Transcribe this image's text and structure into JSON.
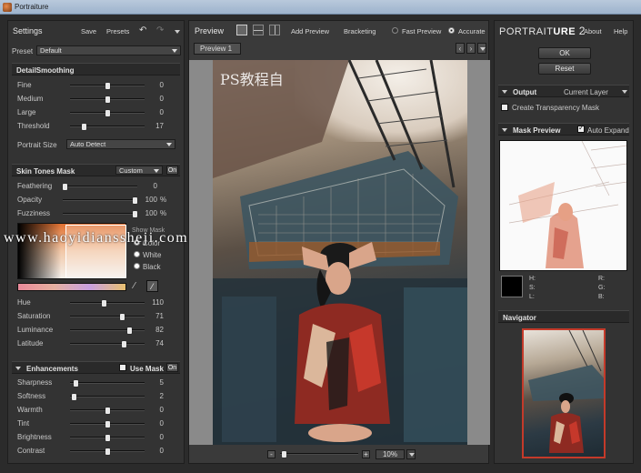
{
  "window": {
    "title": "Portraiture"
  },
  "left": {
    "header": {
      "title": "Settings",
      "save": "Save",
      "presets": "Presets"
    },
    "preset": {
      "label": "Preset",
      "value": "Default"
    },
    "detail": {
      "title": "DetailSmoothing",
      "sliders": [
        {
          "label": "Fine",
          "value": "0",
          "pos": 0.5
        },
        {
          "label": "Medium",
          "value": "0",
          "pos": 0.5
        },
        {
          "label": "Large",
          "value": "0",
          "pos": 0.5
        },
        {
          "label": "Threshold",
          "value": "17",
          "pos": 0.17
        }
      ],
      "portrait_size": {
        "label": "Portrait Size",
        "value": "Auto Detect"
      }
    },
    "skin": {
      "title": "Skin Tones Mask",
      "mode": "Custom",
      "on": "On",
      "sliders": [
        {
          "label": "Feathering",
          "value": "0",
          "unit": "",
          "pos": 0.0
        },
        {
          "label": "Opacity",
          "value": "100",
          "unit": "%",
          "pos": 1.0
        },
        {
          "label": "Fuzziness",
          "value": "100",
          "unit": "%",
          "pos": 1.0
        }
      ],
      "show_mask": "Show Mask",
      "mask_options": [
        "Color",
        "White",
        "Black"
      ],
      "hsl": [
        {
          "label": "Hue",
          "value": "110",
          "pos": 0.45
        },
        {
          "label": "Saturation",
          "value": "71",
          "pos": 0.71
        },
        {
          "label": "Luminance",
          "value": "82",
          "pos": 0.82
        },
        {
          "label": "Latitude",
          "value": "74",
          "pos": 0.74
        }
      ]
    },
    "enh": {
      "title": "Enhancements",
      "use_mask": "Use Mask",
      "on": "On",
      "sliders": [
        {
          "label": "Sharpness",
          "value": "5",
          "pos": 0.05
        },
        {
          "label": "Softness",
          "value": "2",
          "pos": 0.02
        },
        {
          "label": "Warmth",
          "value": "0",
          "pos": 0.5
        },
        {
          "label": "Tint",
          "value": "0",
          "pos": 0.5
        },
        {
          "label": "Brightness",
          "value": "0",
          "pos": 0.5
        },
        {
          "label": "Contrast",
          "value": "0",
          "pos": 0.5
        }
      ]
    }
  },
  "center": {
    "title": "Preview",
    "add_preview": "Add Preview",
    "bracketing": "Bracketing",
    "fast_preview": "Fast Preview",
    "accurate": "Accurate",
    "tab": "Preview 1",
    "zoom": "10%",
    "minus": "-",
    "plus": "+"
  },
  "right": {
    "logo_left": "PORTRAIT",
    "logo_right": "URE",
    "logo_num": "2",
    "about": "About",
    "help": "Help",
    "ok": "OK",
    "reset": "Reset",
    "output": {
      "title": "Output",
      "value": "Current Layer",
      "transparency": "Create Transparency Mask"
    },
    "mask_preview": {
      "title": "Mask Preview",
      "auto_expand": "Auto Expand"
    },
    "readout": {
      "h": "H:",
      "s": "S:",
      "l": "L:",
      "r": "R:",
      "g": "G:",
      "b": "B:"
    },
    "navigator": "Navigator"
  },
  "overlay": {
    "watermark": "www.haoyidianssheji.com",
    "ps_mark": "PS教程自"
  },
  "colors": {
    "panel": "#333333",
    "accent": "#c43a2a"
  }
}
